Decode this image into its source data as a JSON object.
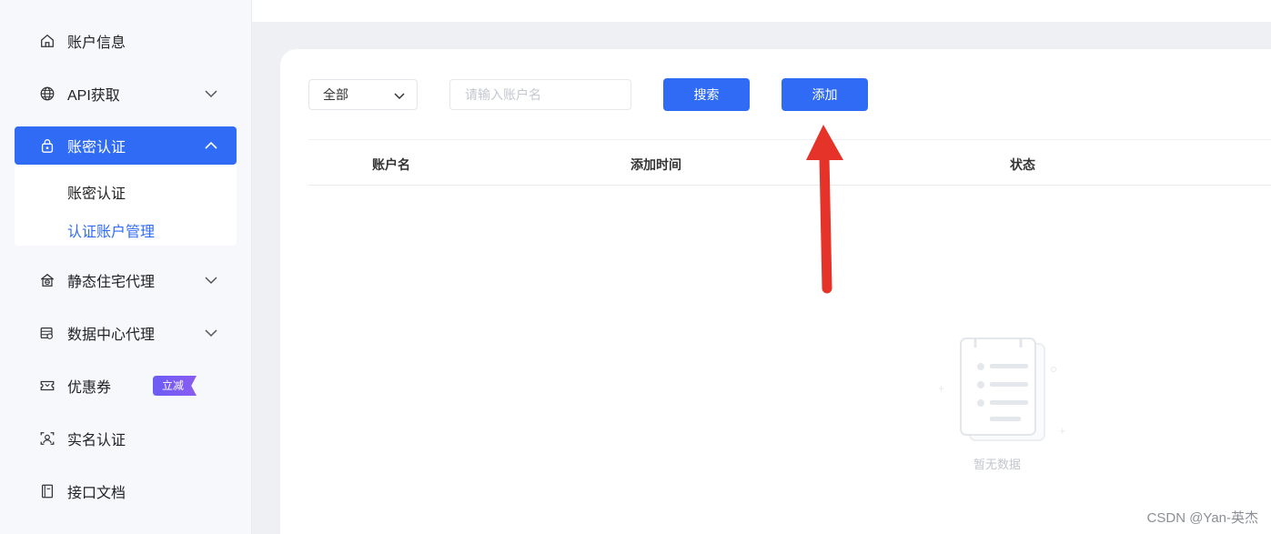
{
  "sidebar": {
    "items": [
      {
        "label": "账户信息",
        "icon": "home-icon"
      },
      {
        "label": "API获取",
        "icon": "globe-icon",
        "expandable": true
      },
      {
        "label": "账密认证",
        "icon": "lock-icon",
        "expandable": true,
        "active": true,
        "children": [
          {
            "label": "账密认证"
          },
          {
            "label": "认证账户管理",
            "current": true
          }
        ]
      },
      {
        "label": "静态住宅代理",
        "icon": "residential-proxy-icon",
        "expandable": true
      },
      {
        "label": "数据中心代理",
        "icon": "datacenter-icon",
        "expandable": true
      },
      {
        "label": "优惠券",
        "icon": "ticket-icon",
        "badge": "立减"
      },
      {
        "label": "实名认证",
        "icon": "id-verify-icon"
      },
      {
        "label": "接口文档",
        "icon": "document-icon"
      }
    ]
  },
  "toolbar": {
    "filter_value": "全部",
    "search_placeholder": "请输入账户名",
    "search_label": "搜索",
    "add_label": "添加"
  },
  "table": {
    "columns": [
      "账户名",
      "添加时间",
      "状态"
    ],
    "rows": [],
    "empty_text": "暂无数据"
  },
  "watermark": "CSDN @Yan-英杰",
  "colors": {
    "primary": "#2f6bf5",
    "annotation_arrow": "#e5332a",
    "badge": "#7a5cf3"
  }
}
